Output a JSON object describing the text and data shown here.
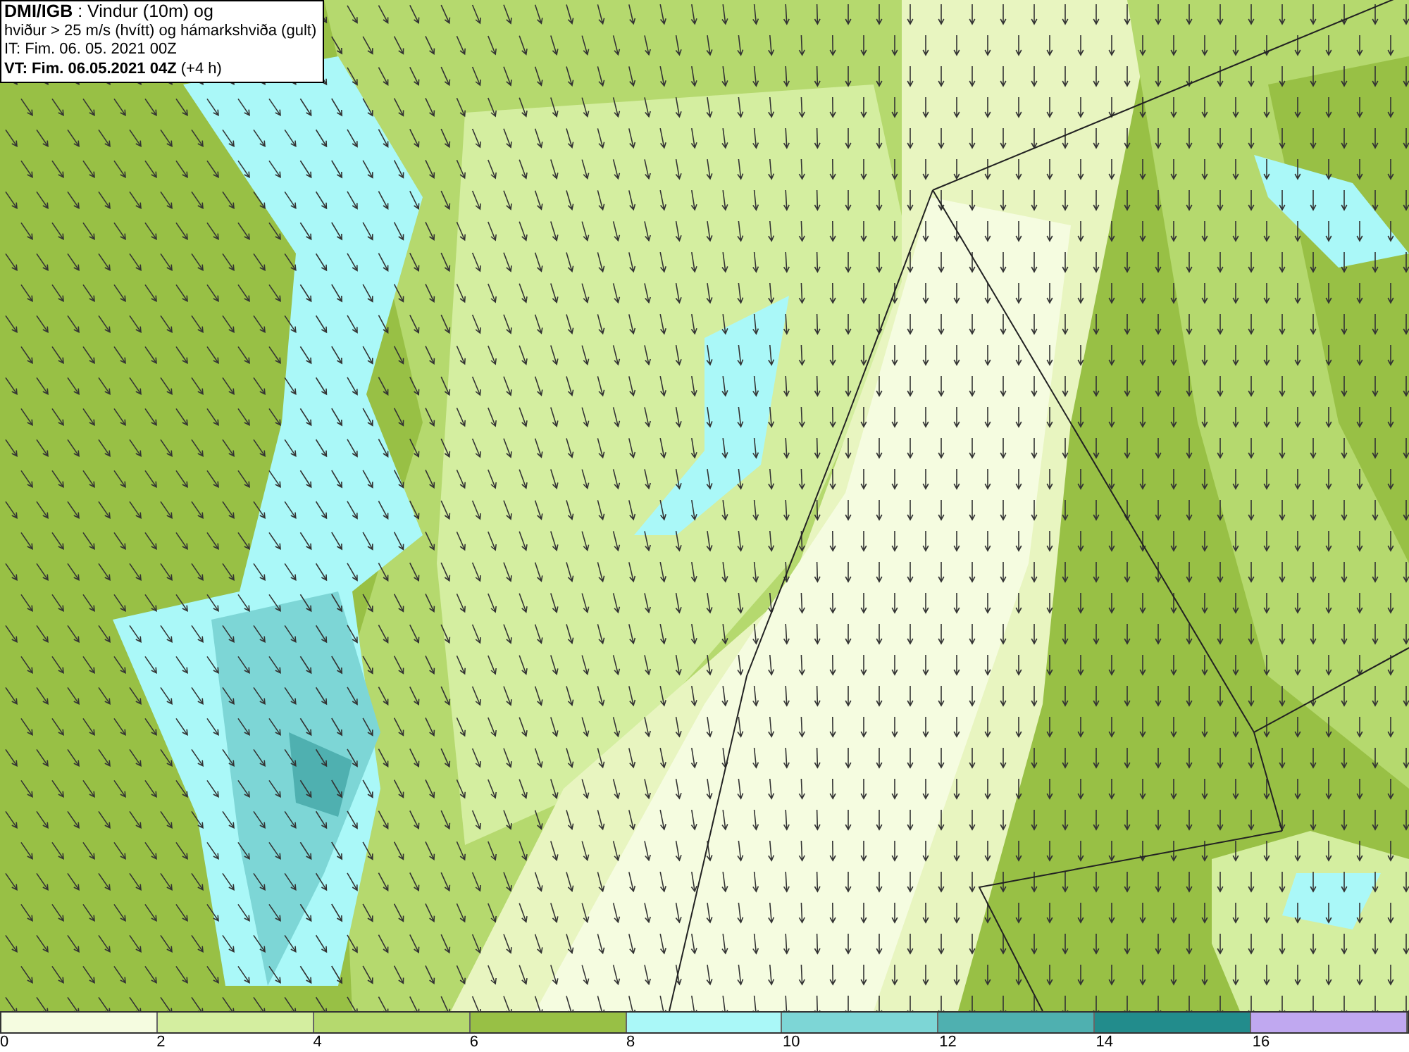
{
  "header": {
    "lines": [
      "**DMI/IGB** : Vindur (10m) og",
      "hviður > 25 m/s (hvítt) og hámarkshviða (gult)",
      "IT: Fim. 06. 05. 2021 00Z",
      "**VT: Fim. 06.05.2021 04Z** (+4 h)"
    ]
  },
  "legend": {
    "segments": [
      {
        "color": "#f5fce0"
      },
      {
        "color": "#d4eea0"
      },
      {
        "color": "#b5d96e"
      },
      {
        "color": "#98c045"
      },
      {
        "color": "#aaf8f8"
      },
      {
        "color": "#7dd6d6"
      },
      {
        "color": "#4fb0b0"
      },
      {
        "color": "#228c8c"
      },
      {
        "color": "#c0a8f0"
      }
    ],
    "ticks": [
      "0",
      "2",
      "4",
      "6",
      "8",
      "10",
      "12",
      "14",
      "16"
    ]
  }
}
